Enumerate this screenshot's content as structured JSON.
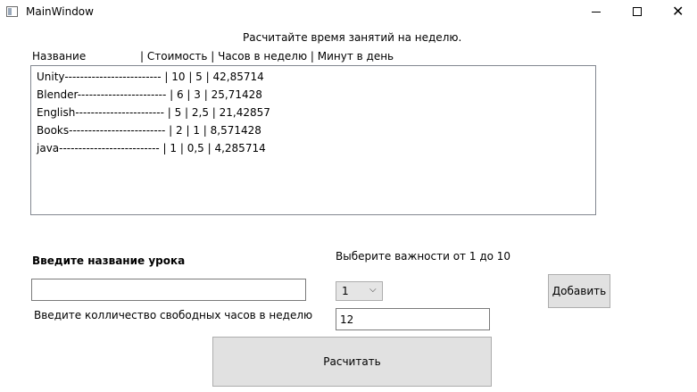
{
  "window": {
    "title": "MainWindow",
    "minimize_symbol": "—",
    "maximize_symbol": "☐",
    "close_symbol": "✕"
  },
  "prompt": "Расчитайте время занятий на неделю.",
  "list_header": {
    "name": "Название",
    "rest": "| Стоимость | Часов в неделю | Минут в день"
  },
  "list_items": [
    "Unity------------------------- | 10 | 5 | 42,85714",
    "Blender----------------------- | 6 | 3 | 25,71428",
    "English----------------------- | 5 | 2,5 | 21,42857",
    "Books------------------------- | 2 | 1 | 8,571428",
    "java-------------------------- | 1 | 0,5 | 4,285714"
  ],
  "form": {
    "lesson_label": "Введите название урока",
    "lesson_value": "",
    "priority_label": "Выберите важности от 1 до 10",
    "priority_value": "1",
    "hours_label": "Введите колличество свободных часов в неделю",
    "hours_value": "12",
    "add_button": "Добавить",
    "calculate_button": "Расчитать"
  },
  "icons": {
    "app": "window-app-icon",
    "combo_arrow": "chevron-down-icon"
  }
}
